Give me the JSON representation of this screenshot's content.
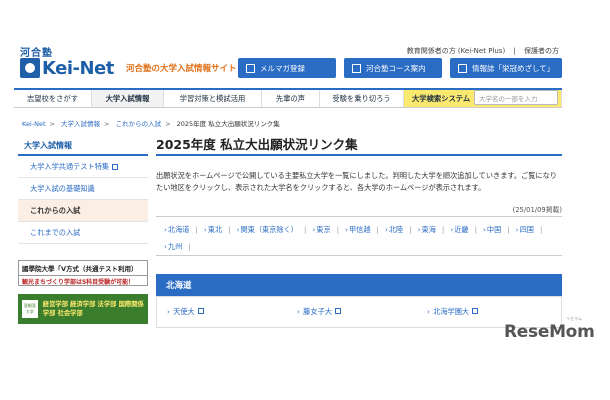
{
  "logo": {
    "small": "河合塾",
    "main": "Kei-Net",
    "tagline": "河合塾の大学入試情報サイト"
  },
  "top_links": {
    "link1": "教育関係者の方 (Kei-Net Plus)",
    "sep": "|",
    "link2": "保護者の方"
  },
  "top_buttons": [
    "メルマガ登録",
    "河合塾コース案内",
    "情報誌「栄冠めざして」"
  ],
  "nav": [
    "志望校をさがす",
    "大学入試情報",
    "学習対策と模試活用",
    "先輩の声",
    "受験を乗り切ろう",
    "大学検索システム"
  ],
  "search": {
    "placeholder": "大学名の一部を入力"
  },
  "breadcrumb": [
    "Kei-Net",
    "大学入試情報",
    "これからの入試",
    "2025年度 私立大出願状況リンク集"
  ],
  "sidebar": {
    "heading": "大学入試情報",
    "items": [
      "大学入学共通テスト特集",
      "大学入試の基礎知識",
      "これからの入試",
      "これまでの入試"
    ]
  },
  "ads": {
    "banner1_line1": "國學院大學「V方式（共通テスト利用）",
    "banner1_line2": "観光まちづくり学部は5科目受験が可能！",
    "banner2_left": "亜細亜大学",
    "banner2_right": "経営学部 経済学部 法学部 国際関係学部 社会学部"
  },
  "main": {
    "title": "2025年度 私立大出願状況リンク集",
    "desc": "出願状況をホームページで公開している主要私立大学を一覧にしました。判明した大学を順次追加していきます。ご覧になりたい地区をクリックし、表示された大学名をクリックすると、各大学のホームページが表示されます。",
    "date": "(25/01/09掲載)",
    "regions": [
      "北海道",
      "東北",
      "関東（東京除く）",
      "東京",
      "甲信越",
      "北陸",
      "東海",
      "近畿",
      "中国",
      "四国",
      "九州"
    ],
    "section": {
      "heading": "北海道",
      "links": [
        "天使大",
        "藤女子大",
        "北海学園大"
      ]
    }
  },
  "watermark": {
    "text": "ReseMom",
    "ruby": "リセマム"
  }
}
